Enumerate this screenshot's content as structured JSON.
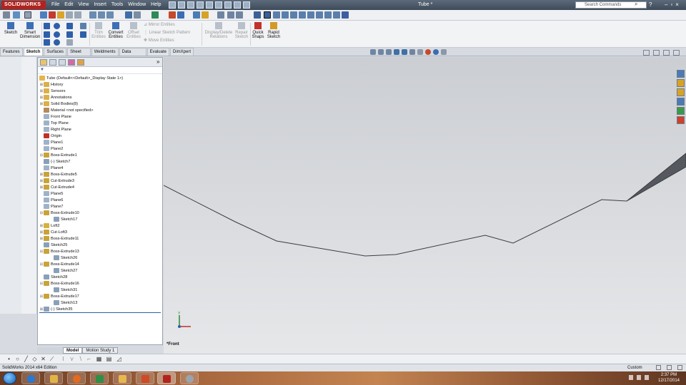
{
  "app": {
    "logo_text": "SOLIDWORKS",
    "document_title": "Tube *",
    "menu": [
      "File",
      "Edit",
      "View",
      "Insert",
      "Tools",
      "Window",
      "Help"
    ],
    "search_placeholder": "Search Commands"
  },
  "commandmanager": {
    "sketch": "Sketch",
    "smart_dimension": [
      "Smart",
      "Dimension"
    ],
    "trim": [
      "Trim",
      "Entities"
    ],
    "convert": [
      "Convert",
      "Entities"
    ],
    "offset": [
      "Offset",
      "Entities"
    ],
    "mirror": "Mirror Entities",
    "linear_pattern": "Linear Sketch Pattern",
    "move": "Move Entities",
    "display_delete": [
      "Display/Delete",
      "Relations"
    ],
    "repair": [
      "Repair",
      "Sketch"
    ],
    "quick_snaps": [
      "Quick",
      "Snaps"
    ],
    "rapid_sketch": [
      "Rapid",
      "Sketch"
    ]
  },
  "tabs": [
    "Features",
    "Sketch",
    "Surfaces",
    "Sheet Metal",
    "Weldments",
    "Data Migration",
    "Evaluate",
    "DimXpert"
  ],
  "active_tab": "Sketch",
  "tree": {
    "root": "Tube  (Default<<Default>_Display State 1>)",
    "items": [
      {
        "label": "History",
        "icon": "history-icon",
        "level": 1,
        "expander": "+"
      },
      {
        "label": "Sensors",
        "icon": "sensors-icon",
        "level": 1,
        "expander": "+"
      },
      {
        "label": "Annotations",
        "icon": "annotations-icon",
        "level": 1,
        "expander": "+"
      },
      {
        "label": "Solid Bodies(8)",
        "icon": "solid-bodies-icon",
        "level": 1,
        "expander": "+"
      },
      {
        "label": "Material <not specified>",
        "icon": "material-icon",
        "level": 1,
        "expander": ""
      },
      {
        "label": "Front Plane",
        "icon": "plane-icon",
        "level": 1,
        "expander": ""
      },
      {
        "label": "Top Plane",
        "icon": "plane-icon",
        "level": 1,
        "expander": ""
      },
      {
        "label": "Right Plane",
        "icon": "plane-icon",
        "level": 1,
        "expander": ""
      },
      {
        "label": "Origin",
        "icon": "origin-icon",
        "level": 1,
        "expander": ""
      },
      {
        "label": "Plane1",
        "icon": "plane-icon",
        "level": 1,
        "expander": ""
      },
      {
        "label": "Plane2",
        "icon": "plane-icon",
        "level": 1,
        "expander": ""
      },
      {
        "label": "Boss-Extrude1",
        "icon": "extrude-icon",
        "level": 1,
        "expander": "-"
      },
      {
        "label": "(-) Sketch7",
        "icon": "sketch-icon",
        "level": 1,
        "expander": ""
      },
      {
        "label": "Plane4",
        "icon": "plane-icon",
        "level": 1,
        "expander": ""
      },
      {
        "label": "Boss-Extrude5",
        "icon": "extrude-icon",
        "level": 1,
        "expander": "+"
      },
      {
        "label": "Cut-Extrude3",
        "icon": "cut-icon",
        "level": 1,
        "expander": "+"
      },
      {
        "label": "Cut-Extrude4",
        "icon": "cut-icon",
        "level": 1,
        "expander": "+"
      },
      {
        "label": "Plane5",
        "icon": "plane-icon",
        "level": 1,
        "expander": ""
      },
      {
        "label": "Plane6",
        "icon": "plane-icon",
        "level": 1,
        "expander": ""
      },
      {
        "label": "Plane7",
        "icon": "plane-icon",
        "level": 1,
        "expander": ""
      },
      {
        "label": "Boss-Extrude10",
        "icon": "extrude-icon",
        "level": 1,
        "expander": "-"
      },
      {
        "label": "Sketch17",
        "icon": "sketch-icon",
        "level": 2,
        "expander": ""
      },
      {
        "label": "Loft2",
        "icon": "loft-icon",
        "level": 1,
        "expander": "+"
      },
      {
        "label": "Cut-Loft3",
        "icon": "cut-icon",
        "level": 1,
        "expander": "+"
      },
      {
        "label": "Boss-Extrude11",
        "icon": "extrude-icon",
        "level": 1,
        "expander": "+"
      },
      {
        "label": "Sketch25",
        "icon": "sketch-icon",
        "level": 1,
        "expander": ""
      },
      {
        "label": "Boss-Extrude13",
        "icon": "extrude-icon",
        "level": 1,
        "expander": "-"
      },
      {
        "label": "Sketch26",
        "icon": "sketch-icon",
        "level": 2,
        "expander": ""
      },
      {
        "label": "Boss-Extrude14",
        "icon": "extrude-icon",
        "level": 1,
        "expander": "-"
      },
      {
        "label": "Sketch27",
        "icon": "sketch-icon",
        "level": 2,
        "expander": ""
      },
      {
        "label": "Sketch28",
        "icon": "sketch-icon",
        "level": 1,
        "expander": ""
      },
      {
        "label": "Boss-Extrude16",
        "icon": "extrude-icon",
        "level": 1,
        "expander": "-"
      },
      {
        "label": "Sketch31",
        "icon": "sketch-icon",
        "level": 2,
        "expander": ""
      },
      {
        "label": "Boss-Extrude17",
        "icon": "extrude-icon",
        "level": 1,
        "expander": "-"
      },
      {
        "label": "Sketch13",
        "icon": "sketch-icon",
        "level": 2,
        "expander": ""
      },
      {
        "label": "(-) Sketch35",
        "icon": "sketch-icon",
        "level": 1,
        "expander": "+"
      }
    ]
  },
  "model_tabs": [
    "Model",
    "Motion Study 1"
  ],
  "viewport": {
    "view_label": "*Front",
    "part_color": "#55585e",
    "triad_y_label": "Y"
  },
  "status": {
    "edition": "SolidWorks 2014 x64 Edition",
    "units": "Custom"
  },
  "clock": {
    "time": "2:37 PM",
    "date": "12/17/2014"
  },
  "colors": {
    "accent": "#b3231d",
    "rollback": "#2b5fab"
  }
}
